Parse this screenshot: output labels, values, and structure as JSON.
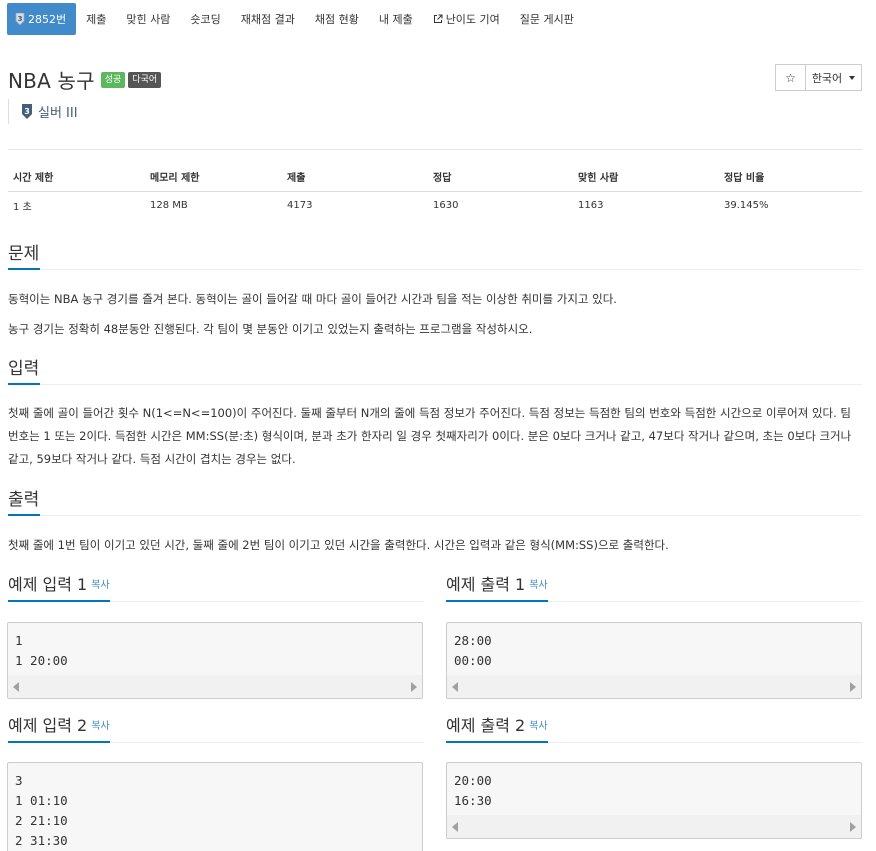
{
  "nav": {
    "tabs": [
      {
        "label": "2852번",
        "active": true,
        "icon": "silver-tier-icon"
      },
      {
        "label": "제출"
      },
      {
        "label": "맞힌 사람"
      },
      {
        "label": "숏코딩"
      },
      {
        "label": "재채점 결과"
      },
      {
        "label": "채점 현황"
      },
      {
        "label": "내 제출"
      },
      {
        "label": "난이도 기여",
        "icon": "external-link-icon"
      },
      {
        "label": "질문 게시판"
      }
    ]
  },
  "problem": {
    "title": "NBA 농구",
    "badges": {
      "success": "성공",
      "multilang": "다국어"
    },
    "tier": "실버 III",
    "tier_number": "3"
  },
  "buttons": {
    "star": "☆",
    "language": "한국어"
  },
  "stats": {
    "headers": [
      "시간 제한",
      "메모리 제한",
      "제출",
      "정답",
      "맞힌 사람",
      "정답 비율"
    ],
    "values": [
      "1 초",
      "128 MB",
      "4173",
      "1630",
      "1163",
      "39.145%"
    ]
  },
  "sections": {
    "description": {
      "heading": "문제",
      "paragraphs": [
        "동혁이는 NBA 농구 경기를 즐겨 본다. 동혁이는 골이 들어갈 때 마다 골이 들어간 시간과 팀을 적는 이상한 취미를 가지고 있다.",
        "농구 경기는 정확히 48분동안 진행된다. 각 팀이 몇 분동안 이기고 있었는지 출력하는 프로그램을 작성하시오."
      ]
    },
    "input": {
      "heading": "입력",
      "text": "첫째 줄에 골이 들어간 횟수 N(1<=N<=100)이 주어진다. 둘째 줄부터 N개의 줄에 득점 정보가 주어진다. 득점 정보는 득점한 팀의 번호와 득점한 시간으로 이루어져 있다. 팀 번호는 1 또는 2이다. 득점한 시간은 MM:SS(분:초) 형식이며, 분과 초가 한자리 일 경우 첫째자리가 0이다. 분은 0보다 크거나 같고, 47보다 작거나 같으며, 초는 0보다 크거나 같고, 59보다 작거나 같다. 득점 시간이 겹치는 경우는 없다."
    },
    "output": {
      "heading": "출력",
      "text": "첫째 줄에 1번 팀이 이기고 있던 시간, 둘째 줄에 2번 팀이 이기고 있던 시간을 출력한다. 시간은 입력과 같은 형식(MM:SS)으로 출력한다."
    }
  },
  "samples": {
    "copy_label": "복사",
    "input1": {
      "title": "예제 입력 1",
      "lines": [
        "1",
        "1 20:00"
      ]
    },
    "output1": {
      "title": "예제 출력 1",
      "lines": [
        "28:00",
        "00:00"
      ]
    },
    "input2": {
      "title": "예제 입력 2",
      "lines": [
        "3",
        "1 01:10",
        "2 21:10",
        "2 31:30"
      ]
    },
    "output2": {
      "title": "예제 출력 2",
      "lines": [
        "20:00",
        "16:30"
      ]
    }
  },
  "colors": {
    "accent": "#428bca",
    "underline": "#0076c0",
    "success": "#5cb85c",
    "multilang": "#555555"
  }
}
